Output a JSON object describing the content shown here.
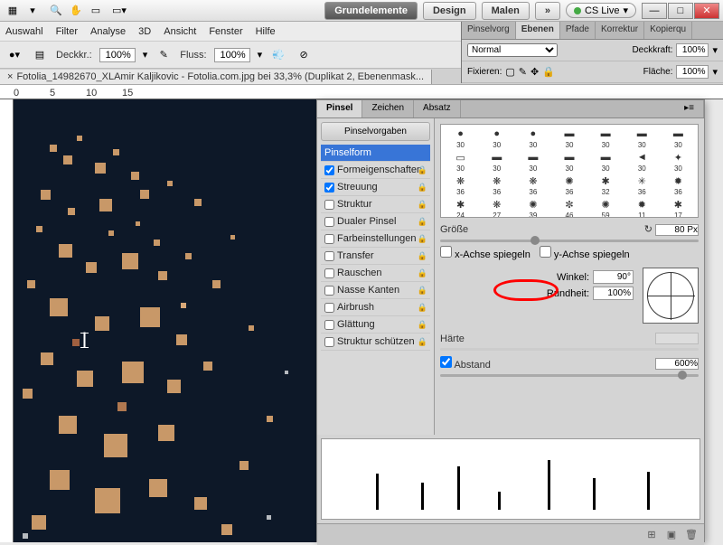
{
  "topbar": {
    "btn_grund": "Grundelemente",
    "btn_design": "Design",
    "btn_malen": "Malen",
    "btn_more": "»",
    "cslive": "CS Live"
  },
  "menu": [
    "Auswahl",
    "Filter",
    "Analyse",
    "3D",
    "Ansicht",
    "Fenster",
    "Hilfe"
  ],
  "optbar": {
    "deckkr_lbl": "Deckkr.:",
    "deckkr_val": "100%",
    "fluss_lbl": "Fluss:",
    "fluss_val": "100%"
  },
  "doc": {
    "title": "Fotolia_14982670_XLAmir Kaljikovic - Fotolia.com.jpg bei 33,3% (Duplikat 2, Ebenenmask..."
  },
  "ruler_marks": [
    "0",
    "5",
    "10",
    "15"
  ],
  "layers_panel": {
    "tabs": [
      "Pinselvorg",
      "Ebenen",
      "Pfade",
      "Korrektur",
      "Kopierqu"
    ],
    "active_tab": 1,
    "blend_label": "Normal",
    "deckkraft_lbl": "Deckkraft:",
    "deckkraft_val": "100%",
    "fixieren_lbl": "Fixieren:",
    "flaeche_lbl": "Fläche:",
    "flaeche_val": "100%"
  },
  "brush_panel": {
    "tabs": [
      "Pinsel",
      "Zeichen",
      "Absatz"
    ],
    "active_tab": 0,
    "presets_btn": "Pinselvorgaben",
    "items": [
      {
        "label": "Pinselform",
        "checked": null,
        "sel": true
      },
      {
        "label": "Formeigenschaften",
        "checked": true
      },
      {
        "label": "Streuung",
        "checked": true
      },
      {
        "label": "Struktur",
        "checked": false
      },
      {
        "label": "Dualer Pinsel",
        "checked": false
      },
      {
        "label": "Farbeinstellungen",
        "checked": false
      },
      {
        "label": "Transfer",
        "checked": false
      },
      {
        "label": "Rauschen",
        "checked": false
      },
      {
        "label": "Nasse Kanten",
        "checked": false
      },
      {
        "label": "Airbrush",
        "checked": false
      },
      {
        "label": "Glättung",
        "checked": false
      },
      {
        "label": "Struktur schützen",
        "checked": false
      }
    ],
    "swatches": [
      [
        30,
        30,
        30,
        30,
        30,
        30,
        30
      ],
      [
        30,
        30,
        30,
        30,
        30,
        30,
        30
      ],
      [
        36,
        36,
        36,
        36,
        32,
        36,
        36
      ],
      [
        24,
        27,
        39,
        46,
        59,
        11,
        17
      ]
    ],
    "size_lbl": "Größe",
    "size_val": "80 Px",
    "flip_x": "x-Achse spiegeln",
    "flip_y": "y-Achse spiegeln",
    "winkel_lbl": "Winkel:",
    "winkel_val": "90°",
    "rundheit_lbl": "Rundheit:",
    "rundheit_val": "100%",
    "haerte_lbl": "Härte",
    "abstand_lbl": "Abstand",
    "abstand_val": "600%"
  }
}
